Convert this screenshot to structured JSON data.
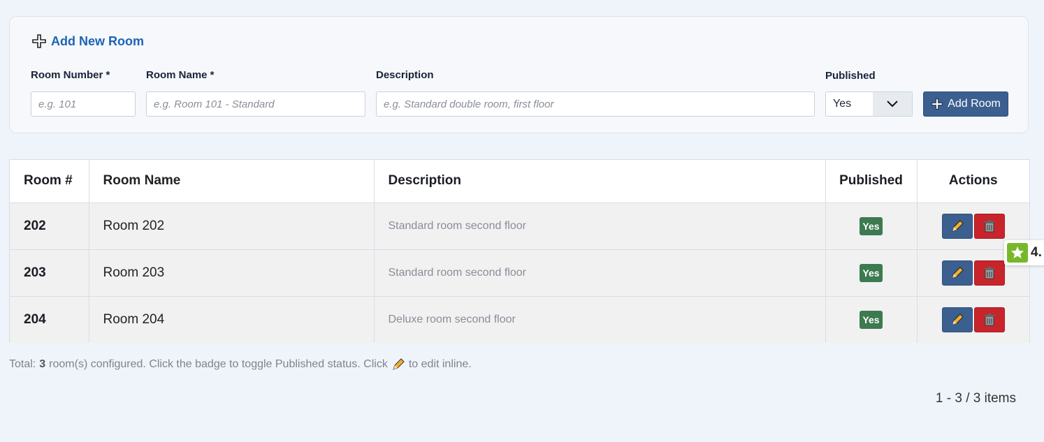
{
  "form": {
    "title": "Add New Room",
    "fields": {
      "room_number": {
        "label": "Room Number *",
        "placeholder": "e.g. 101"
      },
      "room_name": {
        "label": "Room Name *",
        "placeholder": "e.g. Room 101 - Standard"
      },
      "description": {
        "label": "Description",
        "placeholder": "e.g. Standard double room, first floor"
      },
      "published": {
        "label": "Published",
        "value": "Yes"
      }
    },
    "submit_label": "Add Room"
  },
  "table": {
    "headers": {
      "num": "Room #",
      "name": "Room Name",
      "desc": "Description",
      "pub": "Published",
      "act": "Actions"
    },
    "rows": [
      {
        "num": "202",
        "name": "Room 202",
        "desc": "Standard room second floor",
        "pub": "Yes"
      },
      {
        "num": "203",
        "name": "Room 203",
        "desc": "Standard room second floor",
        "pub": "Yes"
      },
      {
        "num": "204",
        "name": "Room 204",
        "desc": "Deluxe room second floor",
        "pub": "Yes"
      }
    ]
  },
  "footer": {
    "prefix": "Total:",
    "count": "3",
    "text_a": "room(s) configured. Click the badge to toggle Published status. Click",
    "text_b": "to edit inline."
  },
  "pager": {
    "text": "1 - 3 / 3 items"
  },
  "rating_widget": {
    "text": "4."
  },
  "colors": {
    "accent": "#1e63b5",
    "primary_button": "#3b5f8f",
    "danger_button": "#c8242b",
    "published_badge": "#3d7a4f"
  }
}
